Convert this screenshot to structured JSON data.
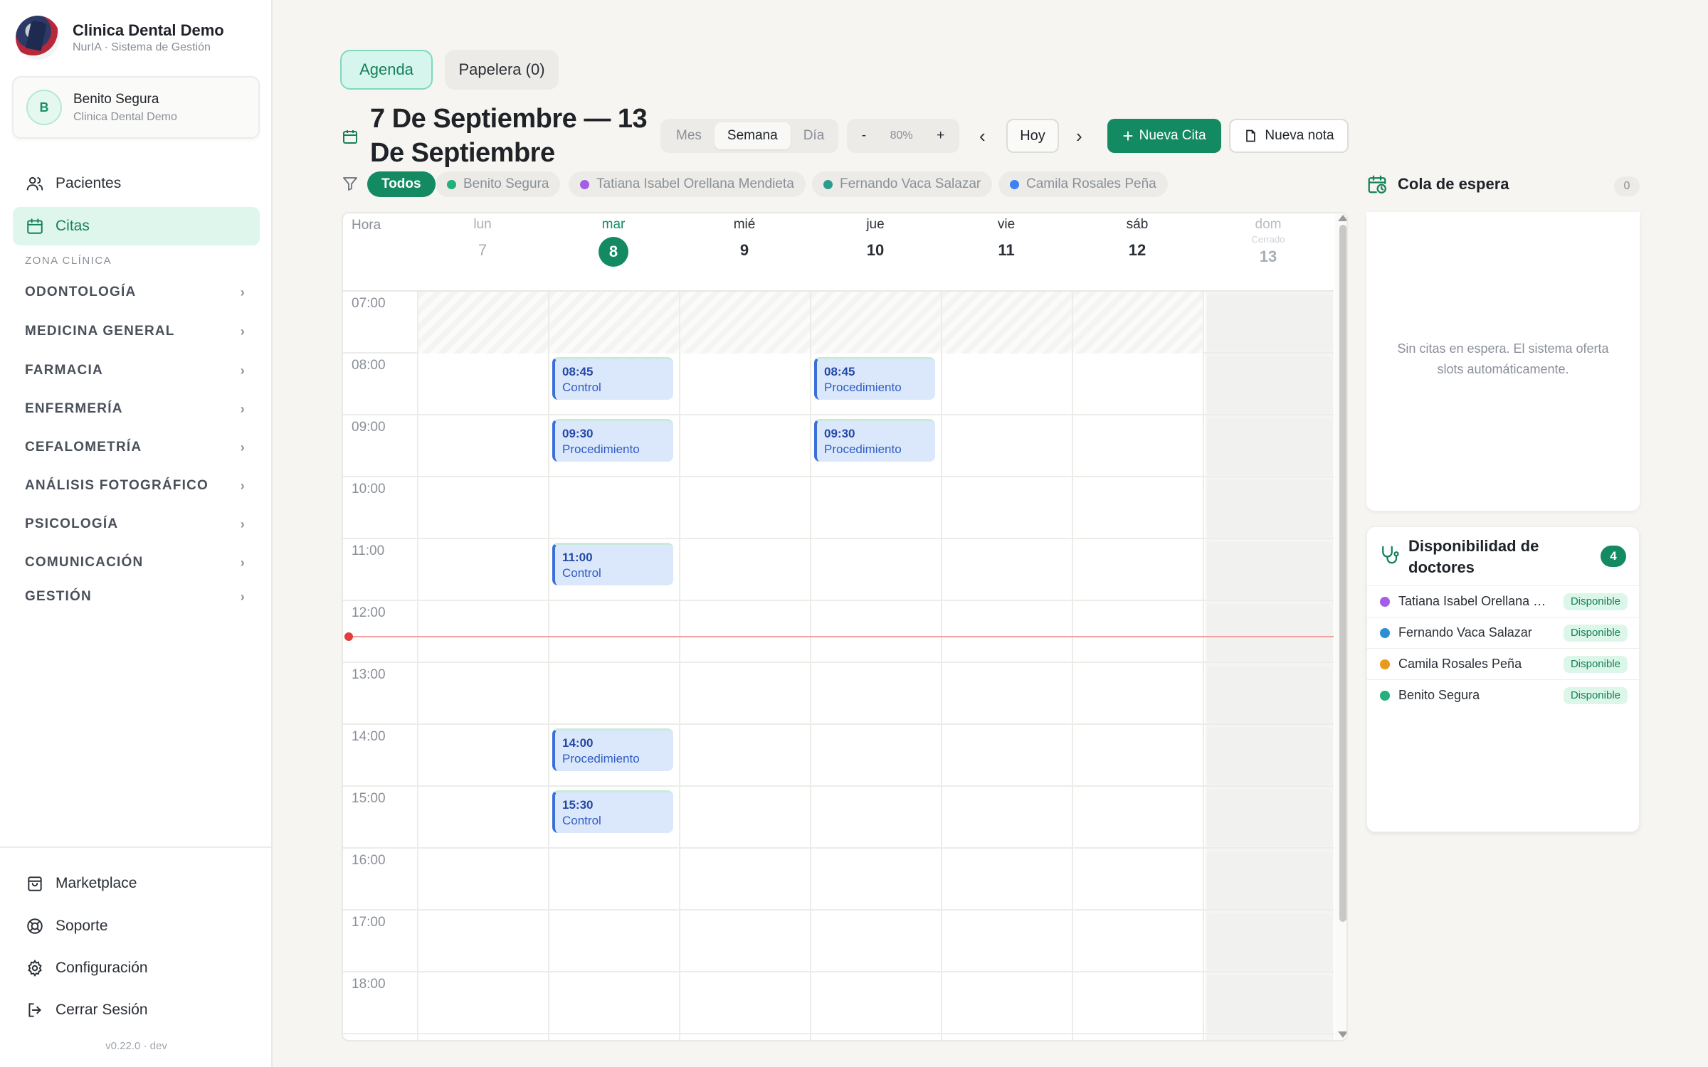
{
  "brand": {
    "title": "Clinica Dental Demo",
    "subtitle": "NurIA · Sistema de Gestión"
  },
  "user": {
    "initial": "B",
    "name": "Benito Segura",
    "org": "Clinica Dental Demo"
  },
  "nav": {
    "pacientes": "Pacientes",
    "citas": "Citas"
  },
  "zona_label": "ZONA CLÍNICA",
  "sections": [
    "ODONTOLOGÍA",
    "MEDICINA GENERAL",
    "FARMACIA",
    "ENFERMERÍA",
    "CEFALOMETRÍA",
    "ANÁLISIS FOTOGRÁFICO",
    "PSICOLOGÍA",
    "COMUNICACIÓN",
    "GESTIÓN"
  ],
  "bottom_nav": {
    "marketplace": "Marketplace",
    "soporte": "Soporte",
    "config": "Configuración",
    "logout": "Cerrar Sesión"
  },
  "version": "v0.22.0 · dev",
  "tabs": {
    "agenda": "Agenda",
    "papelera": "Papelera (0)"
  },
  "range_title": "7 De Septiembre — 13 De Septiembre",
  "view_modes": {
    "mes": "Mes",
    "semana": "Semana",
    "dia": "Día"
  },
  "zoom": {
    "minus": "-",
    "level": "80%",
    "plus": "+"
  },
  "nav_controls": {
    "prev": "‹",
    "today": "Hoy",
    "next": "›"
  },
  "actions": {
    "new_appt": "Nueva Cita",
    "new_note": "Nueva nota"
  },
  "filters": {
    "all": "Todos",
    "doctors": [
      {
        "name": "Benito Segura",
        "color": "#22b07d"
      },
      {
        "name": "Tatiana Isabel Orellana Mendieta",
        "color": "#a35ee8"
      },
      {
        "name": "Fernando Vaca Salazar",
        "color": "#2a9d8f"
      },
      {
        "name": "Camila Rosales Peña",
        "color": "#3b82f6"
      }
    ]
  },
  "calendar": {
    "hora_label": "Hora",
    "days": [
      {
        "name": "lun",
        "num": "7"
      },
      {
        "name": "mar",
        "num": "8"
      },
      {
        "name": "mié",
        "num": "9"
      },
      {
        "name": "jue",
        "num": "10"
      },
      {
        "name": "vie",
        "num": "11"
      },
      {
        "name": "sáb",
        "num": "12"
      },
      {
        "name": "dom",
        "num": "13",
        "note": "Cerrado"
      }
    ],
    "hours": [
      "07:00",
      "08:00",
      "09:00",
      "10:00",
      "11:00",
      "12:00",
      "13:00",
      "14:00",
      "15:00",
      "16:00",
      "17:00",
      "18:00"
    ],
    "appointments": [
      {
        "day": 1,
        "time": "08:45",
        "kind": "Control"
      },
      {
        "day": 1,
        "time": "09:30",
        "kind": "Procedimiento"
      },
      {
        "day": 1,
        "time": "11:00",
        "kind": "Control"
      },
      {
        "day": 1,
        "time": "14:00",
        "kind": "Procedimiento"
      },
      {
        "day": 1,
        "time": "15:30",
        "kind": "Control"
      },
      {
        "day": 3,
        "time": "08:45",
        "kind": "Procedimiento"
      },
      {
        "day": 3,
        "time": "09:30",
        "kind": "Procedimiento"
      }
    ]
  },
  "waitlist": {
    "title": "Cola de espera",
    "count": "0",
    "empty": "Sin citas en espera. El sistema oferta slots automáticamente."
  },
  "availability": {
    "title": "Disponibilidad de doctores",
    "count": "4",
    "doctors": [
      {
        "name": "Tatiana Isabel Orellana Mendieta",
        "status": "Disponible",
        "color": "#a35ee8"
      },
      {
        "name": "Fernando Vaca Salazar",
        "status": "Disponible",
        "color": "#2b8fd6"
      },
      {
        "name": "Camila Rosales Peña",
        "status": "Disponible",
        "color": "#e89a1c"
      },
      {
        "name": "Benito Segura",
        "status": "Disponible",
        "color": "#22b07d"
      }
    ]
  },
  "colors": {
    "accent": "#148a62",
    "accent_soft": "#dff6ec",
    "appt_bg": "#dbe8fb",
    "now_line": "#e23c3c"
  }
}
